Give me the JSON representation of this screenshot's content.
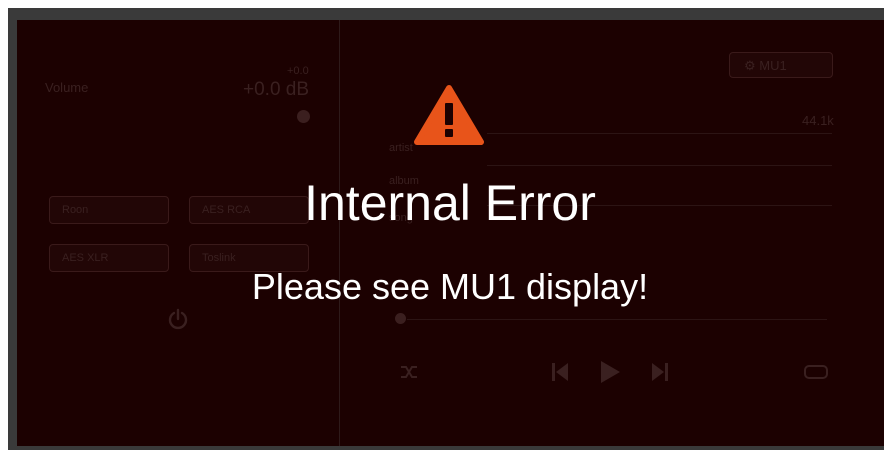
{
  "volume": {
    "label": "Volume",
    "small_value": "+0.0",
    "value": "+0.0 dB"
  },
  "sources": [
    "Roon",
    "AES RCA",
    "AES XLR",
    "Toslink"
  ],
  "device": {
    "label": "MU1"
  },
  "sample_rate": "44.1k",
  "info_labels": [
    "artist",
    "album",
    "song"
  ],
  "icons": {
    "warning": "warning-triangle-icon",
    "power": "power-icon",
    "gear": "gear-icon",
    "shuffle": "shuffle-icon",
    "prev": "skip-previous-icon",
    "play": "play-icon",
    "next": "skip-next-icon",
    "repeat": "repeat-icon"
  },
  "colors": {
    "background": "#1c0101",
    "warning": "#e8541a",
    "text": "#ffffff"
  },
  "error": {
    "title": "Internal Error",
    "message": "Please see MU1 display!"
  }
}
